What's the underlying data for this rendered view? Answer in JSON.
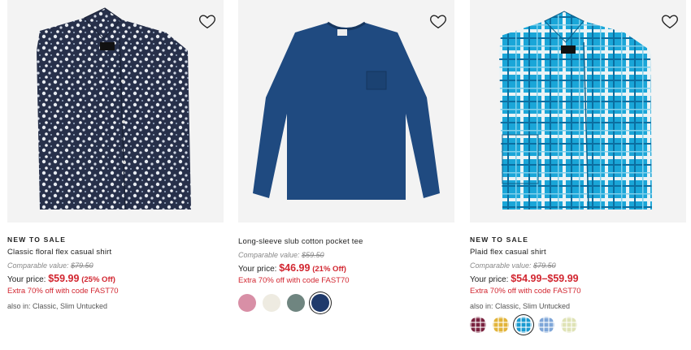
{
  "products": [
    {
      "badge": "NEW TO SALE",
      "name": "Classic floral flex casual shirt",
      "comparable_label": "Comparable value:",
      "comparable_value": "$79.50",
      "price_label": "Your price:",
      "price": "$59.99",
      "discount": "(25% Off)",
      "promo": "Extra 70% off with code FAST70",
      "also_in": "also in: Classic, Slim Untucked",
      "wishlist_icon": "heart-icon"
    },
    {
      "name": "Long-sleeve slub cotton pocket tee",
      "comparable_label": "Comparable value:",
      "comparable_value": "$59.50",
      "price_label": "Your price:",
      "price": "$46.99",
      "discount": "(21% Off)",
      "promo": "Extra 70% off with code FAST70",
      "swatch_colors": [
        "#d88fa6",
        "#eeebe1",
        "#6f8580",
        "#1f3a6b"
      ],
      "selected_swatch": 3,
      "wishlist_icon": "heart-icon"
    },
    {
      "badge": "NEW TO SALE",
      "name": "Plaid flex casual shirt",
      "comparable_label": "Comparable value:",
      "comparable_value": "$79.50",
      "price_label": "Your price:",
      "price": "$54.99–$59.99",
      "promo": "Extra 70% off with code FAST70",
      "also_in": "also in: Classic, Slim Untucked",
      "swatch_colors": [
        "#7a2340",
        "#e2b43a",
        "#1a9ad0",
        "#7fa6d8",
        "#dfe3b6"
      ],
      "selected_swatch": 2,
      "wishlist_icon": "heart-icon"
    }
  ],
  "colors": {
    "sale_red": "#d22630",
    "image_bg": "#f3f3f3"
  }
}
